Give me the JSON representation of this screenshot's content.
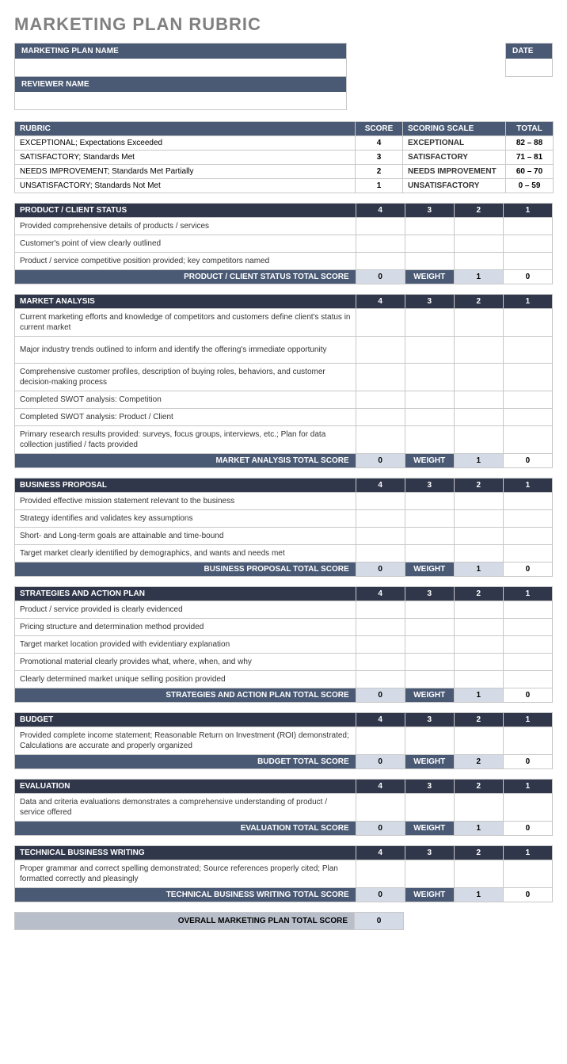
{
  "title": "MARKETING PLAN RUBRIC",
  "header": {
    "name_label": "MARKETING PLAN NAME",
    "name_value": "",
    "date_label": "DATE",
    "date_value": "",
    "reviewer_label": "REVIEWER NAME",
    "reviewer_value": ""
  },
  "rubric": {
    "cols": {
      "rubric": "RUBRIC",
      "score": "SCORE",
      "scale": "SCORING SCALE",
      "total": "TOTAL"
    },
    "rows": [
      {
        "desc": "EXCEPTIONAL; Expectations Exceeded",
        "score": "4",
        "scale": "EXCEPTIONAL",
        "total": "82 – 88"
      },
      {
        "desc": "SATISFACTORY; Standards Met",
        "score": "3",
        "scale": "SATISFACTORY",
        "total": "71 – 81"
      },
      {
        "desc": "NEEDS IMPROVEMENT; Standards Met Partially",
        "score": "2",
        "scale": "NEEDS IMPROVEMENT",
        "total": "60 – 70"
      },
      {
        "desc": "UNSATISFACTORY; Standards Not Met",
        "score": "1",
        "scale": "UNSATISFACTORY",
        "total": "0 – 59"
      }
    ]
  },
  "score_headers": [
    "4",
    "3",
    "2",
    "1"
  ],
  "weight_label": "WEIGHT",
  "sections": [
    {
      "title": "PRODUCT / CLIENT STATUS",
      "criteria": [
        "Provided comprehensive details of products / services",
        "Customer's point of view clearly outlined",
        "Product / service competitive position provided; key competitors named"
      ],
      "total_label": "PRODUCT / CLIENT STATUS TOTAL SCORE",
      "total": "0",
      "weight": "1",
      "weighted": "0"
    },
    {
      "title": "MARKET ANALYSIS",
      "criteria": [
        "Current marketing efforts and knowledge of competitors and customers define client's status in current market",
        "Major industry trends outlined to inform and identify the offering's immediate opportunity",
        "Comprehensive customer profiles, description of buying roles, behaviors, and customer decision-making process",
        "Completed SWOT analysis: Competition",
        "Completed SWOT analysis: Product / Client",
        "Primary research results provided: surveys, focus groups, interviews, etc.; Plan for data collection justified / facts provided"
      ],
      "total_label": "MARKET ANALYSIS TOTAL SCORE",
      "total": "0",
      "weight": "1",
      "weighted": "0"
    },
    {
      "title": "BUSINESS PROPOSAL",
      "criteria": [
        "Provided effective mission statement relevant to the business",
        "Strategy identifies and validates key assumptions",
        "Short- and Long-term goals are attainable and time-bound",
        "Target market clearly identified by demographics, and wants and needs met"
      ],
      "total_label": "BUSINESS PROPOSAL TOTAL SCORE",
      "total": "0",
      "weight": "1",
      "weighted": "0"
    },
    {
      "title": "STRATEGIES AND ACTION PLAN",
      "criteria": [
        "Product / service provided is clearly evidenced",
        "Pricing structure and determination method provided",
        "Target market location provided with evidentiary explanation",
        "Promotional material clearly provides what, where, when, and why",
        "Clearly determined market unique selling position provided"
      ],
      "total_label": "STRATEGIES AND ACTION PLAN TOTAL SCORE",
      "total": "0",
      "weight": "1",
      "weighted": "0"
    },
    {
      "title": "BUDGET",
      "criteria": [
        "Provided complete income statement; Reasonable Return on Investment (ROI) demonstrated; Calculations are accurate and properly organized"
      ],
      "total_label": "BUDGET TOTAL SCORE",
      "total": "0",
      "weight": "2",
      "weighted": "0"
    },
    {
      "title": "EVALUATION",
      "criteria": [
        "Data and criteria evaluations demonstrates a comprehensive understanding of product / service offered"
      ],
      "total_label": "EVALUATION TOTAL SCORE",
      "total": "0",
      "weight": "1",
      "weighted": "0"
    },
    {
      "title": "TECHNICAL BUSINESS WRITING",
      "criteria": [
        "Proper grammar and correct spelling demonstrated; Source references properly cited; Plan formatted correctly and pleasingly"
      ],
      "total_label": "TECHNICAL BUSINESS WRITING TOTAL SCORE",
      "total": "0",
      "weight": "1",
      "weighted": "0"
    }
  ],
  "overall": {
    "label": "OVERALL MARKETING PLAN TOTAL SCORE",
    "value": "0"
  }
}
